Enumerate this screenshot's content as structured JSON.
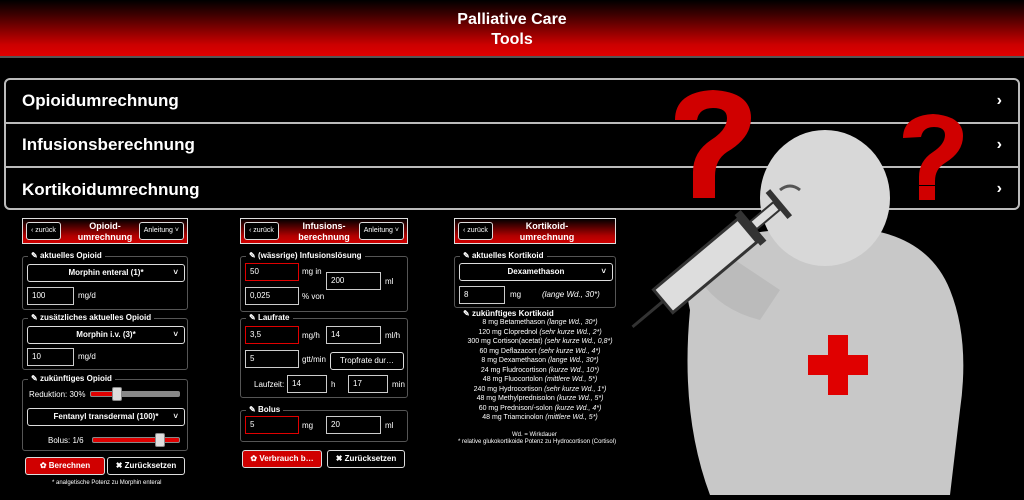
{
  "header": {
    "line1": "Palliative Care",
    "line2": "Tools"
  },
  "menu": [
    {
      "label": "Opioidumrechnung"
    },
    {
      "label": "Infusionsberechnung"
    },
    {
      "label": "Kortikoidumrechnung"
    }
  ],
  "common": {
    "back": "zurück",
    "manual": "Anleitung"
  },
  "opioid": {
    "title": "Opioid-umrechnung",
    "sec1": "aktuelles Opioid",
    "sel1": "Morphin enteral (1)*",
    "val1": "100",
    "unit1": "mg/d",
    "sec2": "zusätzliches aktuelles Opioid",
    "sel2": "Morphin i.v. (3)*",
    "val2": "10",
    "unit2": "mg/d",
    "sec3": "zukünftiges Opioid",
    "reduction": "Reduktion: 30%",
    "reduction_value": 0.3,
    "sel3": "Fentanyl transdermal (100)*",
    "bolus": "Bolus: 1/6",
    "bolus_value": 0.1667,
    "calc": "Berechnen",
    "reset": "Zurücksetzen",
    "note": "* analgetische Potenz zu Morphin enteral"
  },
  "infusion": {
    "title": "Infusions-berechnung",
    "sec1": "(wässrige) Infusionslösung",
    "v1": "50",
    "u1": "mg in",
    "v2": "200",
    "u2": "ml",
    "v3": "0,025",
    "u3": "% von",
    "sec2": "Laufrate",
    "v4": "3,5",
    "u4": "mg/h",
    "v5": "14",
    "u5": "ml/h",
    "v6": "5",
    "u6": "gtt/min",
    "drop": "Tropfrate dur…",
    "runtime": "Laufzeit:",
    "v7": "14",
    "u7": "h",
    "v8": "17",
    "u8": "min",
    "sec3": "Bolus",
    "v9": "5",
    "u9": "mg",
    "v10": "20",
    "u10": "ml",
    "consume": "Verbrauch b…",
    "reset": "Zurücksetzen"
  },
  "cortico": {
    "title": "Kortikoid-umrechnung",
    "sec1": "aktuelles Kortikoid",
    "sel1": "Dexamethason",
    "val1": "8",
    "unit1": "mg",
    "dur1": "(lange Wd., 30*)",
    "sec2": "zukünftiges Kortikoid",
    "list": [
      {
        "a": "8 mg Betamethason",
        "b": "(lange Wd., 30*)"
      },
      {
        "a": "120 mg Cloprednol",
        "b": "(sehr kurze Wd., 2*)"
      },
      {
        "a": "300 mg Cortison(acetat)",
        "b": "(sehr kurze Wd., 0,8*)"
      },
      {
        "a": "60 mg Deflazacort",
        "b": "(sehr kurze Wd., 4*)"
      },
      {
        "a": "8 mg Dexamethason",
        "b": "(lange Wd., 30*)"
      },
      {
        "a": "24 mg Fludrocortison",
        "b": "(kurze Wd., 10*)"
      },
      {
        "a": "48 mg Fluocortolon",
        "b": "(mittlere Wd., 5*)"
      },
      {
        "a": "240 mg Hydrocortison",
        "b": "(sehr kurze Wd., 1*)"
      },
      {
        "a": "48 mg Methylprednisolon",
        "b": "(kurze Wd., 5*)"
      },
      {
        "a": "60 mg Prednison/-solon",
        "b": "(kurze Wd., 4*)"
      },
      {
        "a": "48 mg Triamcinolon",
        "b": "(mittlere Wd., 5*)"
      }
    ],
    "note1": "Wd. = Wirkdauer",
    "note2": "* relative glukokortikoide Potenz zu Hydrocortison (Cortisol)"
  },
  "colors": {
    "accent": "#d00000",
    "bg": "#000000"
  }
}
